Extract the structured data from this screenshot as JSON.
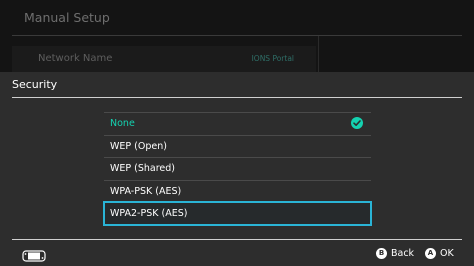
{
  "background_page": {
    "title": "Manual Setup",
    "row_label": "Network Name",
    "row_value": "IONS Portal"
  },
  "dialog": {
    "title": "Security",
    "options": [
      {
        "label": "None",
        "selected": true,
        "focused": false
      },
      {
        "label": "WEP (Open)",
        "selected": false,
        "focused": false
      },
      {
        "label": "WEP (Shared)",
        "selected": false,
        "focused": false
      },
      {
        "label": "WPA-PSK (AES)",
        "selected": false,
        "focused": false
      },
      {
        "label": "WPA2-PSK (AES)",
        "selected": false,
        "focused": true
      }
    ]
  },
  "footer": {
    "back": {
      "glyph": "B",
      "label": "Back"
    },
    "ok": {
      "glyph": "A",
      "label": "OK"
    }
  },
  "colors": {
    "accent": "#14d2b0",
    "focus": "#2ab4d6",
    "background": "#2d2d2d"
  },
  "icons": {
    "selected_indicator": "check-circle-icon",
    "console": "handheld-console-icon"
  }
}
